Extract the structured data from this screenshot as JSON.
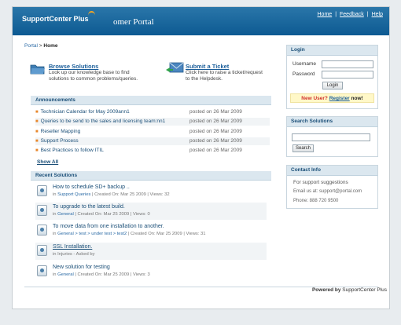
{
  "header": {
    "logo": "SupportCenter Plus",
    "portal_title": "omer Portal",
    "links": [
      "Home",
      "Feedback",
      "Help"
    ],
    "separator": "|"
  },
  "breadcrumb": {
    "portal": "Portal",
    "sep": ">",
    "current": "Home"
  },
  "quick": {
    "browse": {
      "title": "Browse Solutions",
      "desc_l1": "Look up our knowledge base to find",
      "desc_l2": "solutions to common problems/queries."
    },
    "ticket": {
      "title": "Submit a Ticket",
      "desc_l1": "Click here to raise a ticket/request",
      "desc_l2": "to the Helpdesk."
    }
  },
  "announcements": {
    "header": "Announcements",
    "items": [
      {
        "title": "Technician Calendar for May 2009ann1",
        "date": "posted on 26 Mar 2009"
      },
      {
        "title": "Queries to be send to the sales and licensing team:nn1",
        "date": "posted on 26 Mar 2009"
      },
      {
        "title": "Reseller Mapping",
        "date": "posted on 26 Mar 2009"
      },
      {
        "title": "Support Process",
        "date": "posted on 26 Mar 2009"
      },
      {
        "title": "Best Practices to follow ITIL",
        "date": "posted on 26 Mar 2009"
      }
    ],
    "show_all": "Show All"
  },
  "solutions": {
    "header": "Recent Solutions",
    "items": [
      {
        "title": "How to schedule SD+ backup ..",
        "meta_pre": "in ",
        "category": "Support Queries",
        "meta_post": " | Created On: Mar 25 2009 | Views: 32"
      },
      {
        "title": "To upgrade to the latest build.",
        "meta_pre": "in ",
        "category": "General",
        "meta_post": " | Created On: Mar 25 2009 | Views: 0"
      },
      {
        "title": "To move data from one installation to another.",
        "meta_pre": "in ",
        "category": "General > test > under test > test2",
        "meta_post": " | Created On: Mar 25 2009 | Views: 31"
      },
      {
        "title": "SSL Installation.",
        "meta_pre": "in ",
        "category": "Injuries",
        "meta_post": " - Asked by"
      },
      {
        "title": "New solution for testing",
        "meta_pre": "in ",
        "category": "General",
        "meta_post": " | Created On: Mar 25 2009 | Views: 3"
      }
    ]
  },
  "login": {
    "header": "Login",
    "username_label": "Username",
    "password_label": "Password",
    "button": "Login",
    "new_user": "New User?",
    "register": "Register",
    "now": "now!"
  },
  "search": {
    "header": "Search Solutions",
    "button": "Search"
  },
  "contact": {
    "header": "Contact Info",
    "line1": "For support suggestions",
    "line2": "Email us at: support@portal.com",
    "line3": "Phone: 888 720 9500"
  },
  "footer": {
    "powered_by": "Powered by",
    "brand": "SupportCenter Plus"
  },
  "colors": {
    "header_blue": "#0d5a92",
    "section_bg": "#dbe7ef",
    "link": "#1b4f78",
    "accent_orange": "#e8862a"
  }
}
